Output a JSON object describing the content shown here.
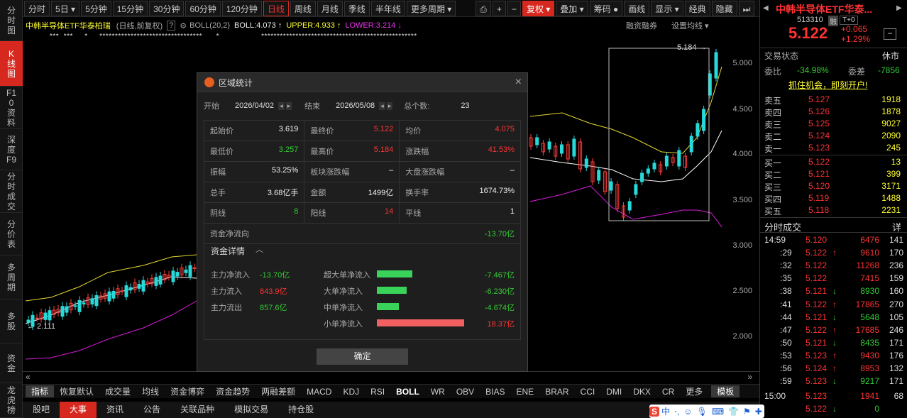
{
  "left_rail": [
    {
      "label": "分时图"
    },
    {
      "label": "K线图"
    },
    {
      "label": "F10资料"
    },
    {
      "label": "深度F9"
    },
    {
      "label": "分时成交"
    },
    {
      "label": "分价表"
    },
    {
      "label": "多周期"
    },
    {
      "label": "多股"
    },
    {
      "label": "资金"
    },
    {
      "label": "龙虎榜"
    }
  ],
  "top_bar": {
    "periods": [
      "分时",
      "5日 ▾",
      "5分钟",
      "15分钟",
      "30分钟",
      "60分钟",
      "120分钟",
      "日线",
      "周线",
      "月线",
      "季线",
      "半年线",
      "更多周期 ▾"
    ],
    "icons": [
      "⎙",
      "+",
      "−"
    ],
    "tools": [
      "复权 ▾",
      "叠加 ▾",
      "筹码 ●",
      "画线",
      "显示 ▾",
      "经典",
      "隐藏",
      "⏭"
    ]
  },
  "legend": {
    "name": "中韩半导体ETF华泰柏瑞",
    "mode": "(日线,前复权)",
    "help": "?",
    "gear": "⚙",
    "boll": "BOLL(20,2)",
    "boll_val": "BOLL:4.073 ↑",
    "upper": "UPPER:4.933 ↑",
    "lower": "LOWER:3.214 ↓",
    "margin": "融资融券",
    "ma": "设置均线 ▾",
    "stars": "***  ***     *     *********************************      *                  **************************************************"
  },
  "axis": {
    "labels": [
      "5.000",
      "4.500",
      "4.000",
      "3.500",
      "3.000",
      "2.500",
      "2.000"
    ],
    "max_label": "5.184",
    "min_label": "2.111"
  },
  "dialog": {
    "title": "区域统计",
    "start_label": "开始",
    "start": "2026/04/02",
    "end_label": "结束",
    "end": "2026/05/08",
    "count_label": "总个数:",
    "count": "23",
    "stats": [
      [
        {
          "k": "起始价",
          "v": "3.619",
          "c": "wht"
        },
        {
          "k": "最终价",
          "v": "5.122",
          "c": "red"
        },
        {
          "k": "均价",
          "v": "4.075",
          "c": "red"
        }
      ],
      [
        {
          "k": "最低价",
          "v": "3.257",
          "c": "grn"
        },
        {
          "k": "最高价",
          "v": "5.184",
          "c": "red"
        },
        {
          "k": "涨跌幅",
          "v": "41.53%",
          "c": "red"
        }
      ],
      [
        {
          "k": "振幅",
          "v": "53.25%",
          "c": "wht"
        },
        {
          "k": "板块涨跌幅",
          "v": "–",
          "c": "wht"
        },
        {
          "k": "大盘涨跌幅",
          "v": "–",
          "c": "wht"
        }
      ],
      [
        {
          "k": "总手",
          "v": "3.68亿手",
          "c": "wht"
        },
        {
          "k": "金额",
          "v": "1499亿",
          "c": "wht"
        },
        {
          "k": "换手率",
          "v": "1674.73%",
          "c": "wht"
        }
      ],
      [
        {
          "k": "阴线",
          "v": "8",
          "c": "grn"
        },
        {
          "k": "阳线",
          "v": "14",
          "c": "red"
        },
        {
          "k": "平线",
          "v": "1",
          "c": "wht"
        }
      ]
    ],
    "net_label": "资金净流向",
    "net_val": "-13.70亿",
    "detail_label": "资金详情",
    "flow_left": [
      {
        "k": "主力净流入",
        "v": "-13.70亿",
        "c": "grn"
      },
      {
        "k": "主力流入",
        "v": "843.9亿",
        "c": "red"
      },
      {
        "k": "主力流出",
        "v": "857.6亿",
        "c": "grn"
      }
    ],
    "flow_right": [
      {
        "k": "超大单净流入",
        "v": "-7.467亿",
        "c": "grn",
        "frac": 0.41,
        "col": "#3ad35a"
      },
      {
        "k": "大单净流入",
        "v": "-6.230亿",
        "c": "grn",
        "frac": 0.34,
        "col": "#3ad35a"
      },
      {
        "k": "中单净流入",
        "v": "-4.674亿",
        "c": "grn",
        "frac": 0.25,
        "col": "#3ad35a"
      },
      {
        "k": "小单净流入",
        "v": "18.37亿",
        "c": "red",
        "frac": 1.0,
        "col": "#f06060"
      }
    ],
    "ok": "确定"
  },
  "indicators": [
    "指标",
    "恢复默认",
    "成交量",
    "均线",
    "资金博弈",
    "资金趋势",
    "两融差额",
    "MACD",
    "KDJ",
    "RSI",
    "BOLL",
    "WR",
    "OBV",
    "BIAS",
    "ENE",
    "BRAR",
    "CCI",
    "DMI",
    "DKX",
    "CR",
    "更多",
    "模板"
  ],
  "bottom_tabs": [
    "股吧",
    "大事",
    "资讯",
    "公告",
    "关联品种",
    "模拟交易",
    "持仓股"
  ],
  "quote": {
    "name": "中韩半导体ETF华泰...",
    "code": "513310",
    "tag1": "融",
    "tag2": "T+0",
    "price": "5.122",
    "chg": "+0.065",
    "pct": "+1.29%",
    "status_label": "交易状态",
    "status": "休市",
    "wb_label": "委比",
    "wb": "-34.98%",
    "wc_label": "委差",
    "wc": "-7856",
    "promo": "抓住机会，即刻开户!"
  },
  "asks": [
    {
      "l": "卖五",
      "p": "5.127",
      "v": "1918"
    },
    {
      "l": "卖四",
      "p": "5.126",
      "v": "1878"
    },
    {
      "l": "卖三",
      "p": "5.125",
      "v": "9027"
    },
    {
      "l": "卖二",
      "p": "5.124",
      "v": "2090"
    },
    {
      "l": "卖一",
      "p": "5.123",
      "v": "245"
    }
  ],
  "bids": [
    {
      "l": "买一",
      "p": "5.122",
      "v": "13"
    },
    {
      "l": "买二",
      "p": "5.121",
      "v": "399"
    },
    {
      "l": "买三",
      "p": "5.120",
      "v": "3171"
    },
    {
      "l": "买四",
      "p": "5.119",
      "v": "1488"
    },
    {
      "l": "买五",
      "p": "5.118",
      "v": "2231"
    }
  ],
  "ticks_label": "分时成交",
  "ticks_more": "详",
  "ticks": [
    {
      "t": "14:59",
      "p": "5.120",
      "a": "",
      "v": "6476",
      "n": "141",
      "vc": "red"
    },
    {
      "t": ":29",
      "p": "5.122",
      "a": "↑",
      "v": "9610",
      "n": "170",
      "vc": "red"
    },
    {
      "t": ":32",
      "p": "5.122",
      "a": "",
      "v": "11268",
      "n": "236",
      "vc": "red"
    },
    {
      "t": ":35",
      "p": "5.122",
      "a": "",
      "v": "7415",
      "n": "159",
      "vc": "red"
    },
    {
      "t": ":38",
      "p": "5.121",
      "a": "↓",
      "v": "8930",
      "n": "160",
      "vc": "grn"
    },
    {
      "t": ":41",
      "p": "5.122",
      "a": "↑",
      "v": "17865",
      "n": "270",
      "vc": "red"
    },
    {
      "t": ":44",
      "p": "5.121",
      "a": "↓",
      "v": "5648",
      "n": "105",
      "vc": "grn"
    },
    {
      "t": ":47",
      "p": "5.122",
      "a": "↑",
      "v": "17685",
      "n": "246",
      "vc": "red"
    },
    {
      "t": ":50",
      "p": "5.121",
      "a": "↓",
      "v": "8435",
      "n": "171",
      "vc": "grn"
    },
    {
      "t": ":53",
      "p": "5.123",
      "a": "↑",
      "v": "9430",
      "n": "176",
      "vc": "red"
    },
    {
      "t": ":56",
      "p": "5.124",
      "a": "↑",
      "v": "8953",
      "n": "132",
      "vc": "red"
    },
    {
      "t": ":59",
      "p": "5.123",
      "a": "↓",
      "v": "9217",
      "n": "171",
      "vc": "grn"
    },
    {
      "t": "15:00",
      "p": "5.123",
      "a": "",
      "v": "1941",
      "n": "68",
      "vc": "red"
    },
    {
      "t": "",
      "p": "5.122",
      "a": "↓",
      "v": "0",
      "n": "",
      "vc": "grn"
    }
  ],
  "ime": [
    "S",
    "中",
    "⋅,",
    "☺",
    "🎙",
    "⌨",
    "👕",
    "⚑",
    "✚"
  ]
}
